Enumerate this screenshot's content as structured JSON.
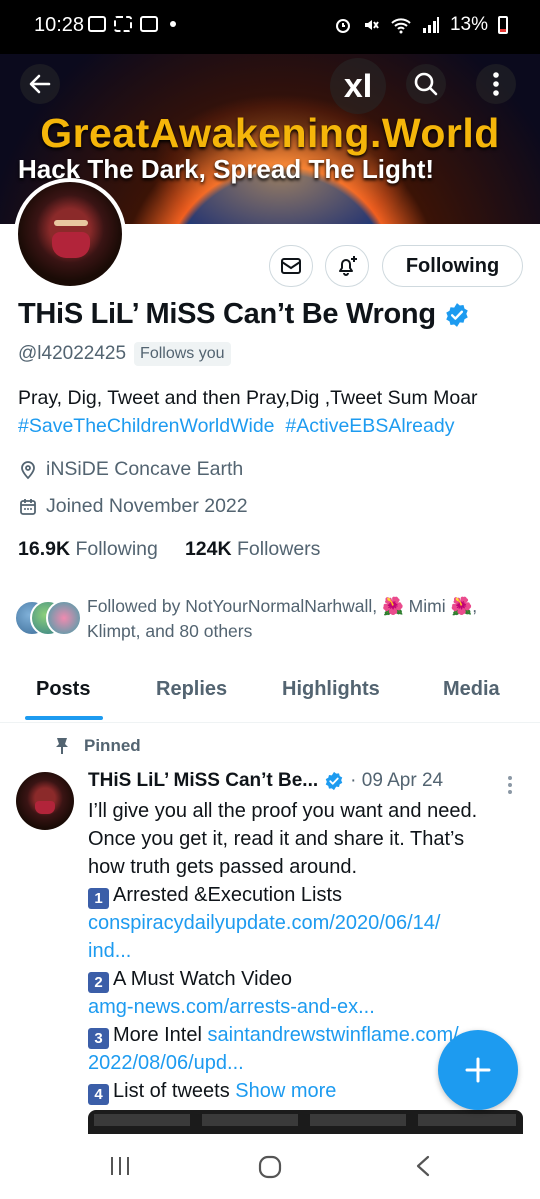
{
  "status_bar": {
    "time": "10:28",
    "battery": "13%",
    "icons": [
      "call-record-icon",
      "scan-icon",
      "gallery-icon",
      "alarm-icon",
      "mute-icon",
      "wifi-icon",
      "signal-icon",
      "battery-icon"
    ]
  },
  "banner": {
    "title": "GreatAwakening.World",
    "subtitle": "Hack The Dark, Spread The Light!",
    "xai_glyph": "xI"
  },
  "profile": {
    "name": "THiS LiL’ MiSS Can’t Be Wrong",
    "handle": "@l42022425",
    "follows_you": "Follows you",
    "bio_line1": "Pray, Dig, Tweet and then Pray,Dig ,Tweet Sum Moar",
    "hashtag1": "#SaveTheChildrenWorldWide",
    "hashtag2": "#ActiveEBSAlready",
    "location": "iNSiDE Concave Earth",
    "joined": "Joined November 2022",
    "following_count": "16.9K",
    "following_label": "Following",
    "followers_count": "124K",
    "followers_label": "Followers",
    "followed_by": "Followed by NotYourNormalNarhwall, 🌺 Mimi 🌺, Klimpt, and 80 others"
  },
  "actions": {
    "following_button": "Following"
  },
  "tabs": [
    {
      "label": "Posts",
      "active": true
    },
    {
      "label": "Replies",
      "active": false
    },
    {
      "label": "Highlights",
      "active": false
    },
    {
      "label": "Media",
      "active": false
    }
  ],
  "pinned_post": {
    "pinned_label": "Pinned",
    "author": "THiS LiL’ MiSS Can’t Be...",
    "date": "· 09 Apr 24",
    "line1": "I’ll give you all the proof you want and need.",
    "line2": "Once you get it, read it and share it. That’s",
    "line3": "how truth gets passed around.",
    "item1_num": "1",
    "item1_text": "Arrested &Execution Lists",
    "item1_link_a": "conspiracydailyupdate.com/2020/06/14/",
    "item1_link_b": "ind...",
    "item2_num": "2",
    "item2_text": "A Must Watch Video",
    "item2_link": "amg-news.com/arrests-and-ex...",
    "item3_num": "3",
    "item3_text": "More Intel",
    "item3_link_a": "saintandrewstwinflame.com/",
    "item3_link_b": "2022/08/06/upd...",
    "item4_num": "4",
    "item4_text": "List of tweets",
    "show_more": "Show more"
  },
  "colors": {
    "accent": "#1d9bf0",
    "text": "#0f1419",
    "muted": "#536471",
    "banner_title": "#f5b60a"
  }
}
